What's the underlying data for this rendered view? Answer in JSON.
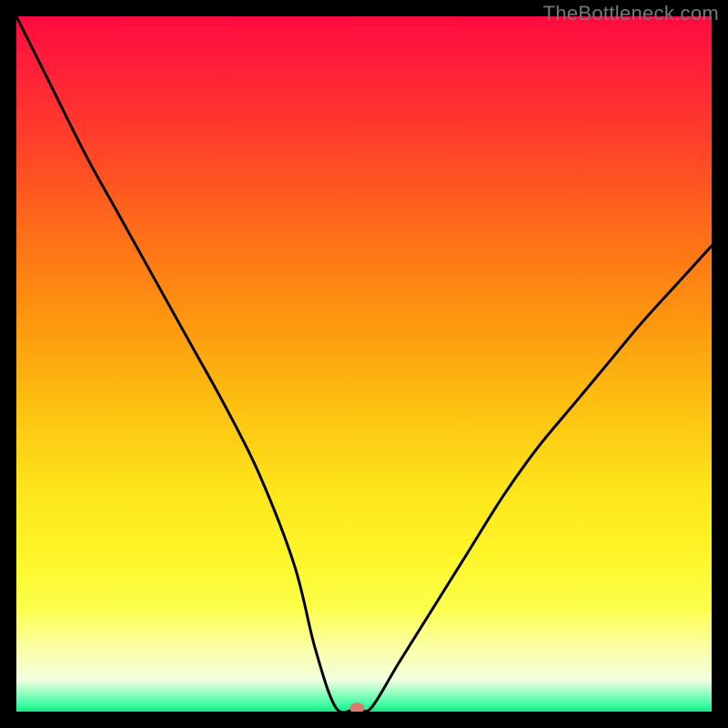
{
  "watermark": "TheBottleneck.com",
  "chart_data": {
    "type": "line",
    "title": "",
    "xlabel": "",
    "ylabel": "",
    "xlim": [
      0,
      100
    ],
    "ylim": [
      0,
      100
    ],
    "series": [
      {
        "name": "curve",
        "x": [
          0,
          5,
          10,
          15,
          20,
          25,
          30,
          35,
          40,
          43,
          46,
          49,
          51,
          55,
          60,
          65,
          70,
          75,
          80,
          85,
          90,
          95,
          100
        ],
        "y": [
          100,
          90,
          80,
          71,
          62,
          53,
          44,
          34,
          21,
          9,
          0.5,
          0.5,
          0.5,
          7,
          15,
          23,
          31,
          38,
          44,
          50,
          56,
          61.5,
          67
        ]
      }
    ],
    "marker": {
      "x": 49,
      "y": 0.5,
      "color": "#d97a6a"
    },
    "background_gradient": {
      "stops": [
        {
          "offset": 0.0,
          "color": "#ff0a3f"
        },
        {
          "offset": 0.07,
          "color": "#ff1f39"
        },
        {
          "offset": 0.18,
          "color": "#ff4029"
        },
        {
          "offset": 0.3,
          "color": "#ff6a1a"
        },
        {
          "offset": 0.42,
          "color": "#fd910f"
        },
        {
          "offset": 0.55,
          "color": "#fdbd10"
        },
        {
          "offset": 0.68,
          "color": "#fde51a"
        },
        {
          "offset": 0.78,
          "color": "#fdf62a"
        },
        {
          "offset": 0.85,
          "color": "#fcff4a"
        },
        {
          "offset": 0.905,
          "color": "#fbffa0"
        },
        {
          "offset": 0.955,
          "color": "#f2ffe0"
        },
        {
          "offset": 0.99,
          "color": "#3dfca2"
        },
        {
          "offset": 1.0,
          "color": "#14e884"
        }
      ]
    }
  }
}
